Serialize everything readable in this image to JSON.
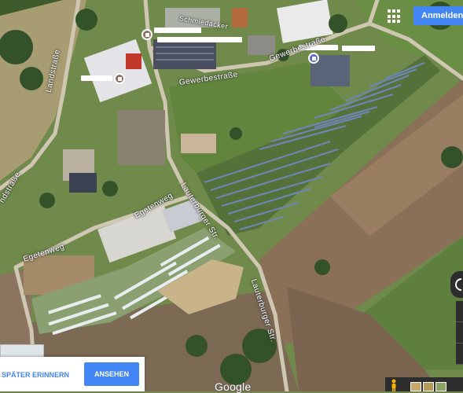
{
  "header": {
    "signin_label": "Anmelden",
    "apps_icon": "apps-grid-icon"
  },
  "streets": {
    "landstrasse": "Landstraße",
    "landstrasse_lower": "ndstraße",
    "gewerbestrasse_1": "Gewerbestraße",
    "gewerbestrasse_2": "Gewerbestraße",
    "lauterburger_1": "Lauterburger Str.",
    "lauterburger_2": "Lauterburger Str.",
    "egetenweg_1": "Egetenweg",
    "egetenweg_2": "Egetenweg",
    "schmiedacker": "Schmiedacker"
  },
  "notice": {
    "remind_later": "SPÄTER ERINNERN",
    "view_label": "ANSEHEN"
  },
  "footer": {
    "google_logo": "Google"
  },
  "colors": {
    "accent": "#4285f4",
    "control_dark": "#2d2d2d"
  }
}
